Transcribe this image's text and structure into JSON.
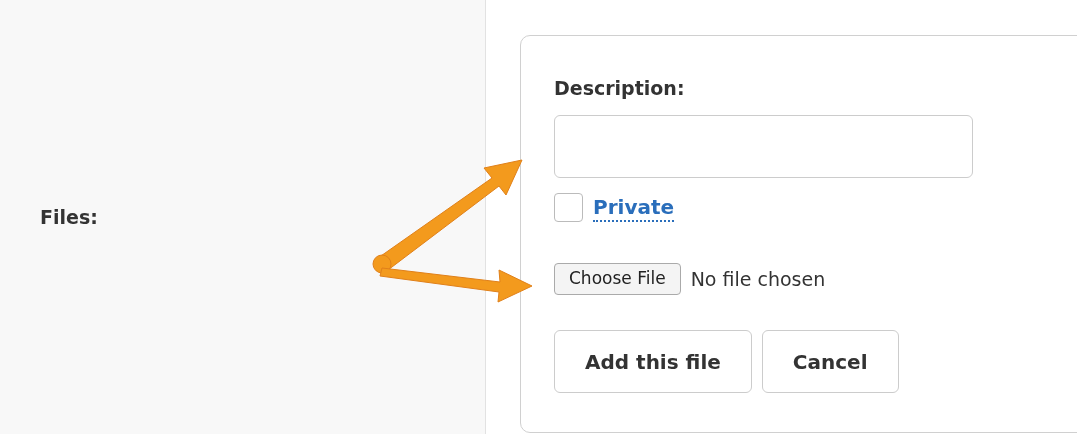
{
  "field_label": "Files:",
  "form": {
    "description_label": "Description:",
    "private": {
      "label": "Private",
      "checked": false
    },
    "file_input": {
      "button": "Choose File",
      "status": "No file chosen"
    },
    "buttons": [
      "Add this file",
      "Cancel"
    ]
  }
}
